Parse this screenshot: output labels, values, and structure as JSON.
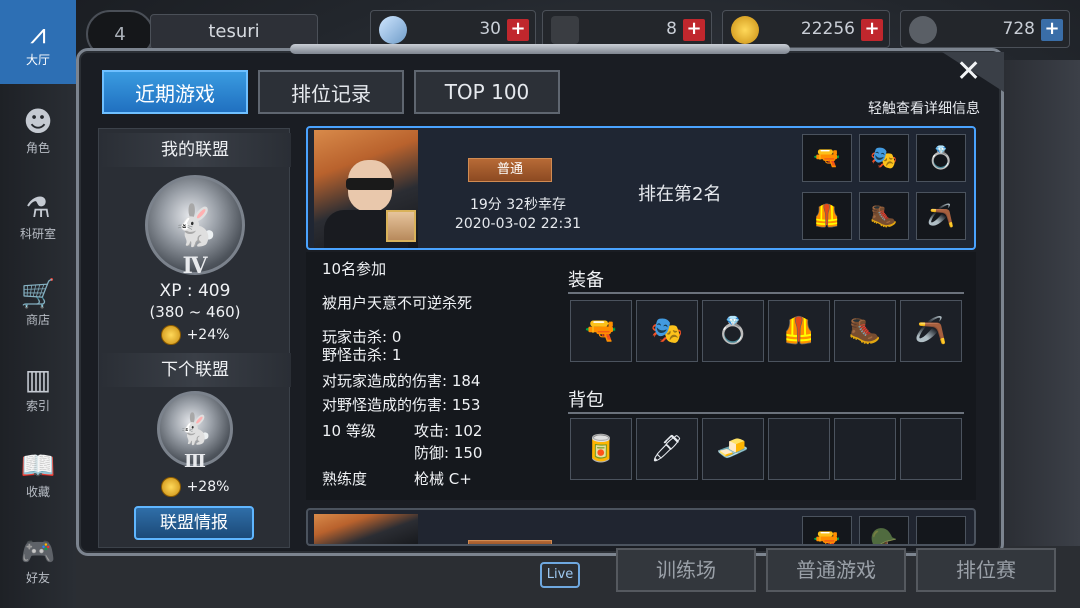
{
  "nav": [
    {
      "label": "大厅",
      "icon": "lobby-icon",
      "glyph": "⩘"
    },
    {
      "label": "角色",
      "icon": "character-icon",
      "glyph": "☻"
    },
    {
      "label": "科研室",
      "icon": "lab-flask-icon",
      "glyph": "⚗"
    },
    {
      "label": "商店",
      "icon": "shop-cart-icon",
      "glyph": "🛒"
    },
    {
      "label": "索引",
      "icon": "index-books-icon",
      "glyph": "▥"
    },
    {
      "label": "收藏",
      "icon": "collection-book-icon",
      "glyph": "📖"
    },
    {
      "label": "好友",
      "icon": "friends-gamepad-icon",
      "glyph": "🎮"
    }
  ],
  "topbar": {
    "level": "4",
    "username": "tesuri",
    "resources": [
      {
        "name": "crystal",
        "value": "30",
        "icon": "crystal-icon",
        "add": "+"
      },
      {
        "name": "ticket",
        "value": "8",
        "icon": "ticket-icon",
        "add": "+"
      },
      {
        "name": "gold",
        "value": "22256",
        "icon": "gold-coin-icon",
        "add": "+"
      },
      {
        "name": "bp",
        "value": "728",
        "icon": "bp-icon",
        "add": "+"
      }
    ]
  },
  "dialog": {
    "close": "✕",
    "tabs": [
      "近期游戏",
      "排位记录",
      "TOP 100"
    ],
    "hint": "轻触查看详细信息"
  },
  "league": {
    "my_title": "我的联盟",
    "my_tier": "Ⅳ",
    "xp": "XP : 409",
    "range": "(380 ~ 460)",
    "bonus": "+24%",
    "next_title": "下个联盟",
    "next_tier": "Ⅲ",
    "next_bonus": "+28%",
    "button": "联盟情报"
  },
  "record": {
    "mode": "普通",
    "survival": "19分 32秒幸存",
    "datetime": "2020-03-02 22:31",
    "rank": "排在第2名",
    "slots": [
      "🔫",
      "🎭",
      "💍",
      "🦺",
      "🥾",
      "🪃"
    ]
  },
  "record2": {
    "slots": [
      "🔫",
      "🪖",
      ""
    ]
  },
  "detail": {
    "participants": "10名参加",
    "death": "被用户天意不可逆杀死",
    "player_kills": "玩家击杀: 0",
    "monster_kills": "野怪击杀: 1",
    "dmg_players": "对玩家造成的伤害: 184",
    "dmg_monsters": "对野怪造成的伤害: 153",
    "level": "10 等级",
    "attack": "攻击: 102",
    "defense": "防御: 150",
    "prof_label": "熟练度",
    "prof_value": "枪械 C+",
    "equip_title": "装备",
    "equip": [
      "🔫",
      "🎭",
      "💍",
      "🦺",
      "🥾",
      "🪃"
    ],
    "bag_title": "背包",
    "bag": [
      "🥫",
      "🖊",
      "🧈",
      "",
      "",
      ""
    ]
  },
  "bottom": {
    "training": "训练场",
    "normal": "普通游戏",
    "ranked": "排位赛",
    "live": "Live"
  },
  "colors": {
    "accent": "#2d6fb4",
    "tab_active": "#3a9be0",
    "border": "#7c848f",
    "badge": "#b76a36"
  }
}
